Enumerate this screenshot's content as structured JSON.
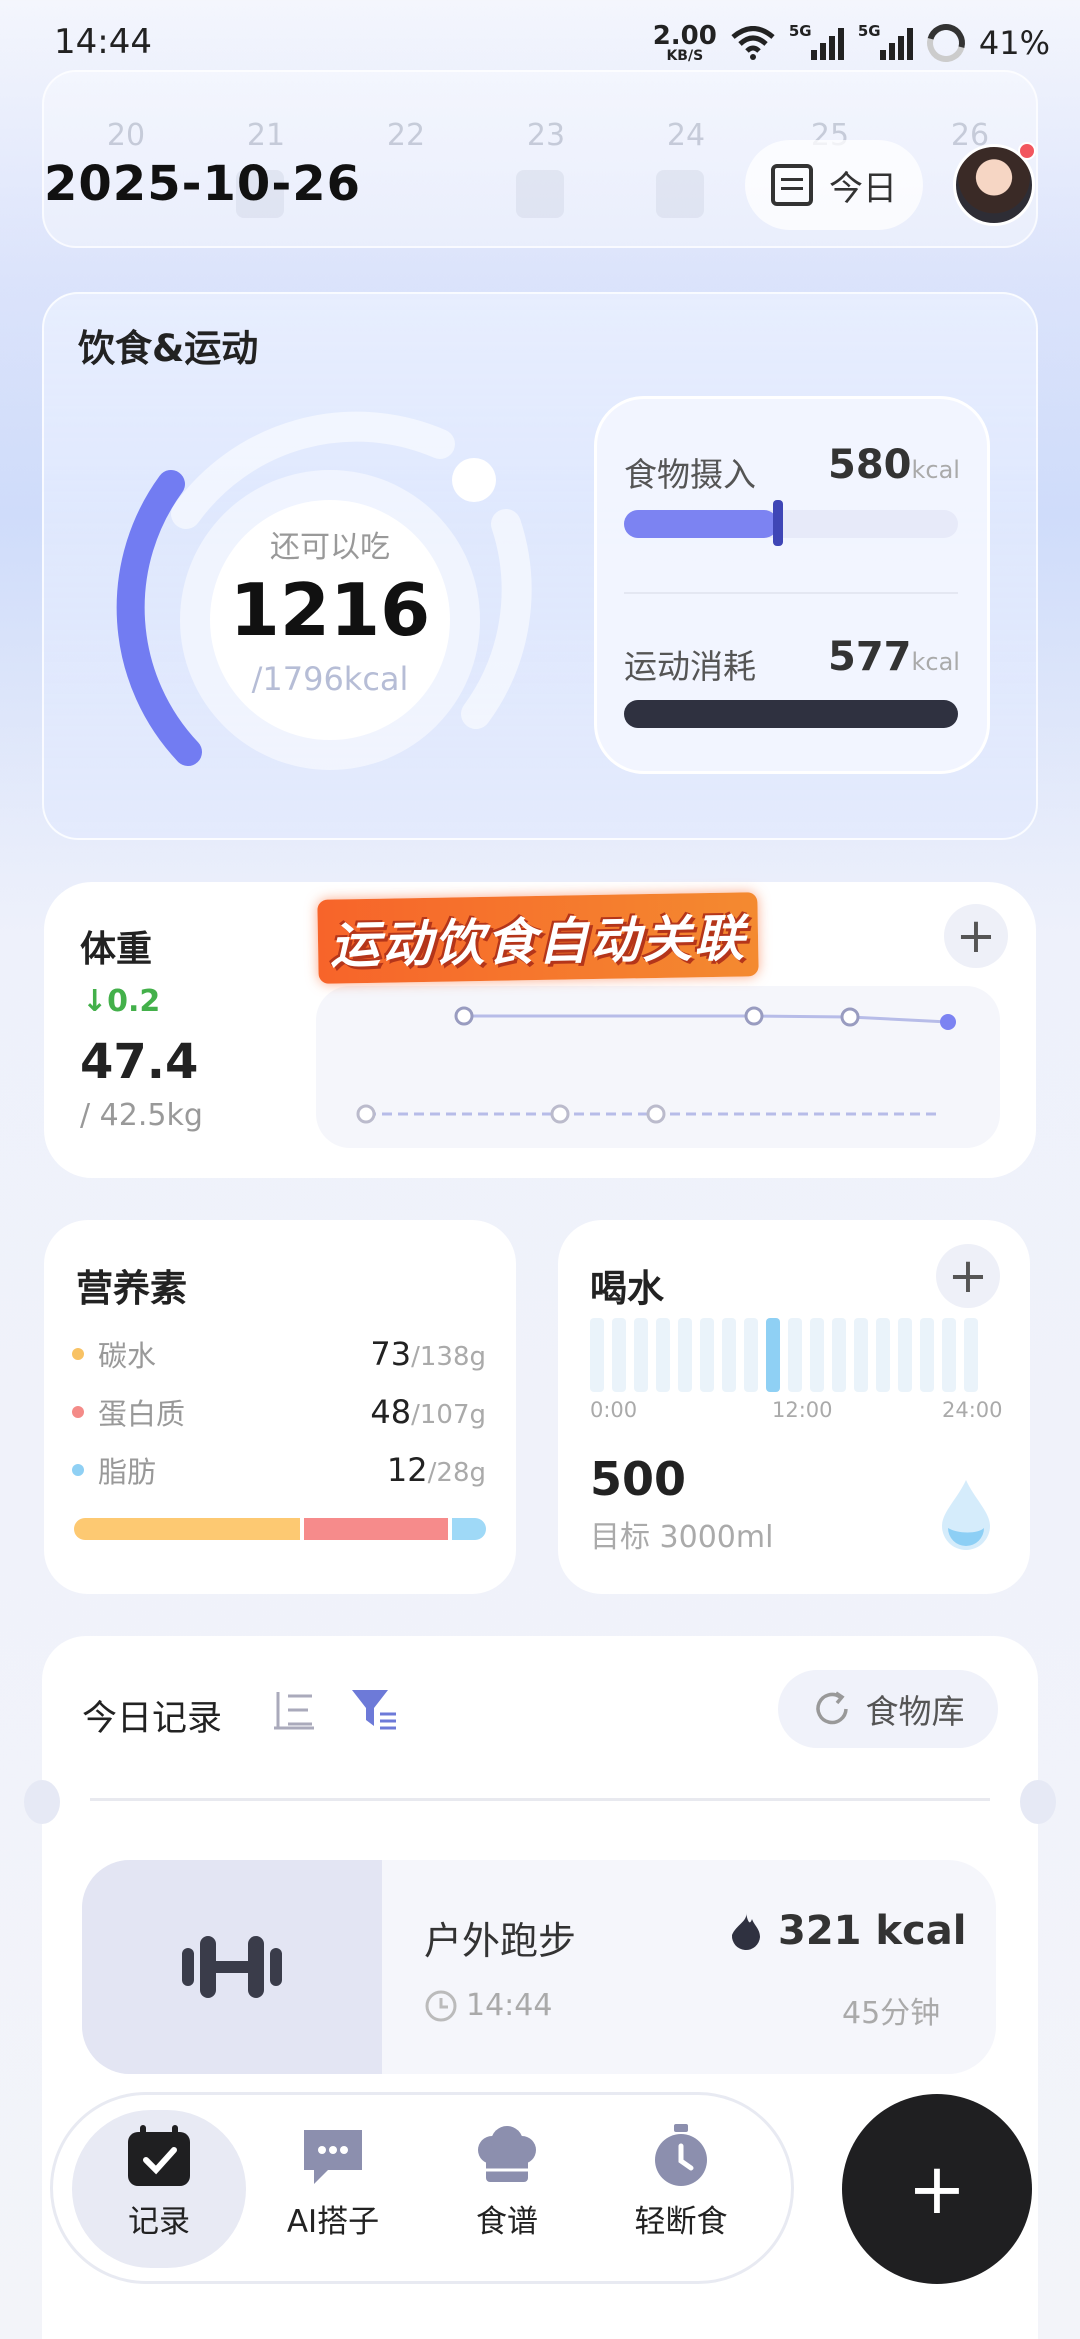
{
  "status_bar": {
    "time": "14:44",
    "net_speed": "2.00",
    "net_unit": "KB/S",
    "signal1_label": "5G",
    "signal2_label": "5G",
    "battery": "41%"
  },
  "header": {
    "date": "2025-10-26",
    "today_label": "今日",
    "week_days": [
      "20",
      "21",
      "22",
      "23",
      "24",
      "25",
      "26"
    ]
  },
  "diet_card": {
    "title": "饮食&运动",
    "remain_label": "还可以吃",
    "remain_value": "1216",
    "remain_total": "/1796kcal",
    "intake_label": "食物摄入",
    "intake_value": "580",
    "intake_unit": "kcal",
    "intake_fraction": 0.46,
    "burn_label": "运动消耗",
    "burn_value": "577",
    "burn_unit": "kcal",
    "burn_fraction": 1.0
  },
  "weight_card": {
    "title": "体重",
    "delta": "↓0.2",
    "value": "47.4",
    "target": "/ 42.5kg",
    "promo": "运动饮食自动关联"
  },
  "nutrition_card": {
    "title": "营养素",
    "items": [
      {
        "name": "碳水",
        "value": "73",
        "total": "/138g",
        "color": "#f8c264"
      },
      {
        "name": "蛋白质",
        "value": "48",
        "total": "/107g",
        "color": "#f48b88"
      },
      {
        "name": "脂肪",
        "value": "12",
        "total": "/28g",
        "color": "#8fd0f4"
      }
    ]
  },
  "water_card": {
    "title": "喝水",
    "time_start": "0:00",
    "time_mid": "12:00",
    "time_end": "24:00",
    "value": "500",
    "goal": "目标 3000ml"
  },
  "records_card": {
    "title": "今日记录",
    "food_library": "食物库",
    "exercise": {
      "name": "户外跑步",
      "time": "14:44",
      "kcal": "321 kcal",
      "duration": "45分钟"
    }
  },
  "bottom_nav": {
    "items": [
      {
        "label": "记录",
        "icon": "calendar-check-icon"
      },
      {
        "label": "AI搭子",
        "icon": "chat-bubble-icon"
      },
      {
        "label": "食谱",
        "icon": "chef-hat-icon"
      },
      {
        "label": "轻断食",
        "icon": "stopwatch-icon"
      }
    ],
    "fab": "+"
  },
  "colors": {
    "accent": "#7078f0",
    "dark": "#2f3140",
    "water": "#8fd0f4",
    "green": "#43b04a"
  }
}
